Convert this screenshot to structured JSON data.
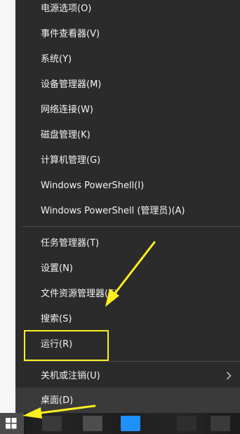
{
  "context_menu": {
    "items_group1": [
      {
        "label": "电源选项(O)"
      },
      {
        "label": "事件查看器(V)"
      },
      {
        "label": "系统(Y)"
      },
      {
        "label": "设备管理器(M)"
      },
      {
        "label": "网络连接(W)"
      },
      {
        "label": "磁盘管理(K)"
      },
      {
        "label": "计算机管理(G)"
      },
      {
        "label": "Windows PowerShell(I)"
      },
      {
        "label": "Windows PowerShell (管理员)(A)"
      }
    ],
    "items_group2": [
      {
        "label": "任务管理器(T)"
      },
      {
        "label": "设置(N)"
      },
      {
        "label": "文件资源管理器(E)"
      },
      {
        "label": "搜索(S)"
      },
      {
        "label": "运行(R)"
      }
    ],
    "items_group3": [
      {
        "label": "关机或注销(U)",
        "has_submenu": true,
        "submenu_icon": "chevron-right-icon"
      },
      {
        "label": "桌面(D)"
      }
    ]
  },
  "annotations": {
    "highlight_color": "#fff020",
    "arrow_color": "#fff020",
    "highlighted_item": "运行(R)"
  },
  "taskbar": {
    "start_icon": "windows-logo-icon",
    "accent_color": "#1e90ff"
  },
  "colors": {
    "menu_background": "#2b2b2b",
    "menu_text": "#f3f3f3",
    "separator": "#4a4a4a"
  }
}
